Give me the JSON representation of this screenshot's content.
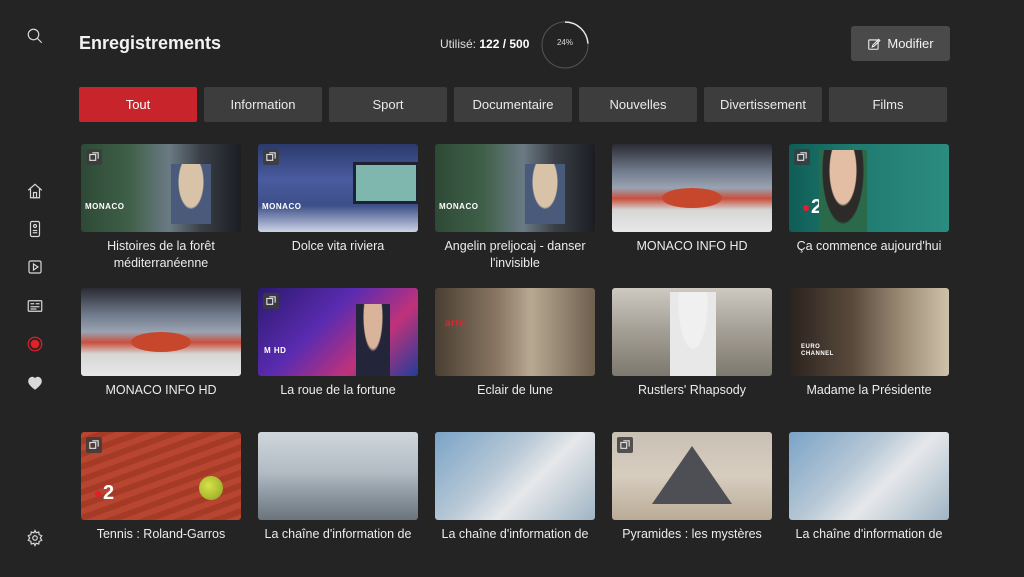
{
  "header": {
    "title": "Enregistrements",
    "storage_label": "Utilisé:",
    "storage_value": "122 / 500",
    "storage_percent_label": "24%",
    "storage_fraction": 0.24,
    "modify_label": "Modifier"
  },
  "sidebar": {
    "items": [
      {
        "icon": "search-icon"
      },
      {
        "icon": "home-icon"
      },
      {
        "icon": "remote-icon"
      },
      {
        "icon": "replay-icon"
      },
      {
        "icon": "guide-icon"
      },
      {
        "icon": "record-icon",
        "active": true
      },
      {
        "icon": "favorites-icon"
      },
      {
        "icon": "settings-icon"
      }
    ]
  },
  "tabs": [
    "Tout",
    "Information",
    "Sport",
    "Documentaire",
    "Nouvelles",
    "Divertissement",
    "Films"
  ],
  "rows": [
    [
      {
        "title": "Histoires de la forêt méditerranéenne",
        "logo": "MONACO",
        "series": true
      },
      {
        "title": "Dolce vita riviera",
        "logo": "MONACO",
        "series": true
      },
      {
        "title": "Angelin preljocaj - danser l'invisible",
        "logo": "MONACO",
        "series": false
      },
      {
        "title": "MONACO INFO HD",
        "logo": "",
        "series": false
      },
      {
        "title": "Ça commence aujourd'hui",
        "logo": "2",
        "series": true
      }
    ],
    [
      {
        "title": "MONACO INFO HD",
        "logo": "",
        "series": false
      },
      {
        "title": "La roue de la fortune",
        "logo": "M HD",
        "series": true
      },
      {
        "title": "Eclair de lune",
        "logo": "arte",
        "series": false
      },
      {
        "title": "Rustlers' Rhapsody",
        "logo": "",
        "series": false
      },
      {
        "title": "Madame la Présidente",
        "logo": "EURO CHANNEL",
        "series": false
      }
    ],
    [
      {
        "title": "Tennis : Roland-Garros",
        "logo": "2",
        "series": true
      },
      {
        "title": "La chaîne d'information de",
        "logo": "",
        "series": false
      },
      {
        "title": "La chaîne d'information de",
        "logo": "",
        "series": false
      },
      {
        "title": "Pyramides : les mystères",
        "logo": "",
        "series": true
      },
      {
        "title": "La chaîne d'information de",
        "logo": "",
        "series": false
      }
    ]
  ],
  "colors": {
    "accent": "#c8242b",
    "background": "#242424",
    "tab": "#3d3d3d"
  }
}
